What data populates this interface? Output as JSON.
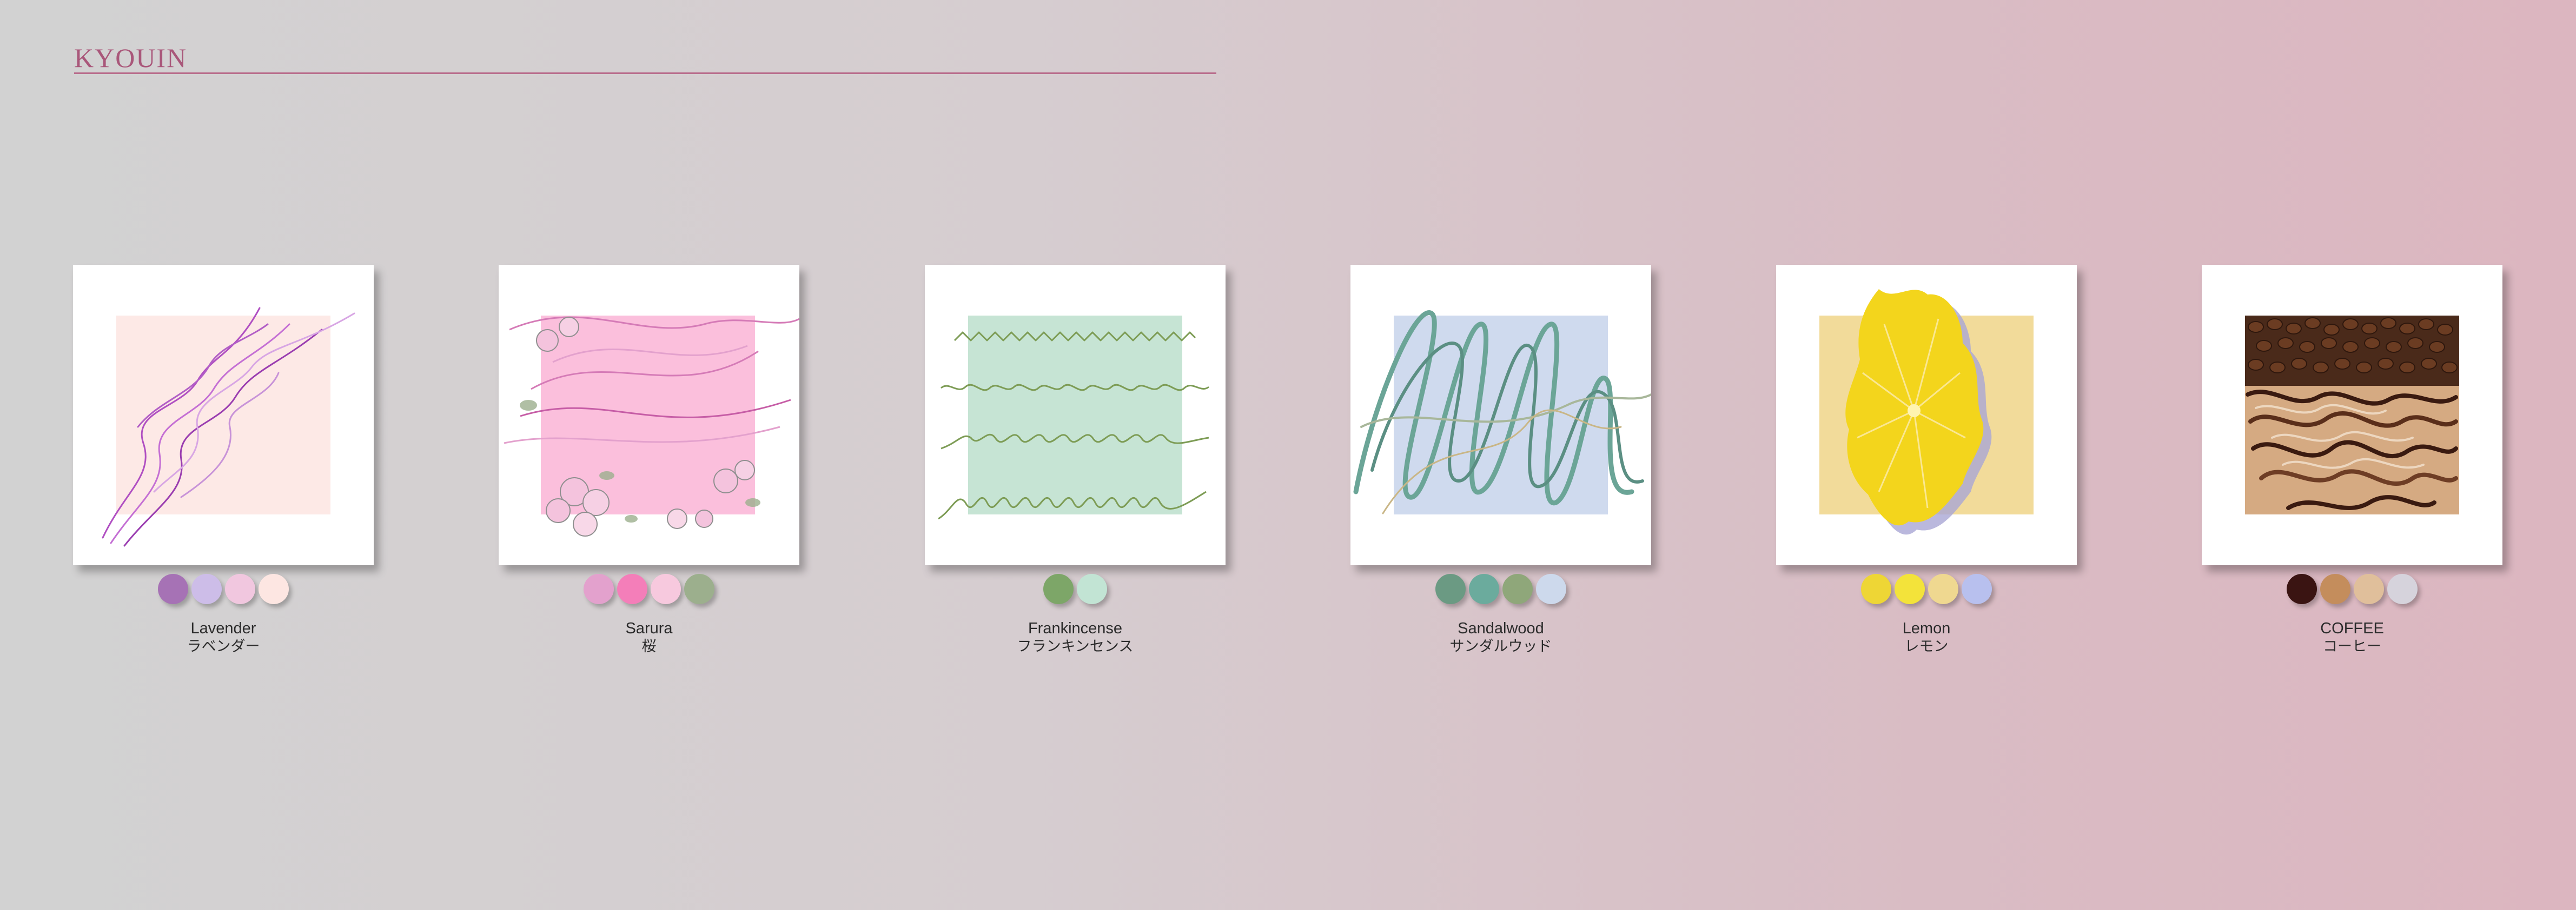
{
  "header": {
    "brand": "KYOUIN"
  },
  "colors": {
    "brand": "#a9577a"
  },
  "cards": [
    {
      "name": "Lavender",
      "name_ja": "ラベンダー",
      "artwork": "purple-swirl-lines",
      "square_color": "#fde9e6",
      "swatches": [
        "#a672b5",
        "#cdbde8",
        "#f1c7df",
        "#fde6e2"
      ]
    },
    {
      "name": "Sarura",
      "name_ja": "桜",
      "artwork": "sakura-flowers-swirl",
      "square_color": "#fbbfdc",
      "swatches": [
        "#e3a1cd",
        "#f47eb9",
        "#f7c9de",
        "#9caf8d"
      ]
    },
    {
      "name": "Frankincense",
      "name_ja": "フランキンセンス",
      "artwork": "green-wavy-lines",
      "square_color": "#c6e4d4",
      "swatches": [
        "#7da668",
        "#c2e4d4"
      ]
    },
    {
      "name": "Sandalwood",
      "name_ja": "サンダルウッド",
      "artwork": "teal-scribble",
      "square_color": "#cfdaee",
      "swatches": [
        "#6b9a83",
        "#6bab9d",
        "#8fa77a",
        "#cdd9ec"
      ]
    },
    {
      "name": "Lemon",
      "name_ja": "レモン",
      "artwork": "lemon-slice",
      "square_color": "#f2db9a",
      "swatches": [
        "#eed635",
        "#f3e33a",
        "#efd890",
        "#b8c0ee"
      ]
    },
    {
      "name": "COFFEE",
      "name_ja": "コーヒー",
      "artwork": "coffee-beans-swirl",
      "square_color": "#d5aa82",
      "swatches": [
        "#3a1412",
        "#c48d5c",
        "#e0bf9b",
        "#d6d3dc"
      ]
    }
  ]
}
